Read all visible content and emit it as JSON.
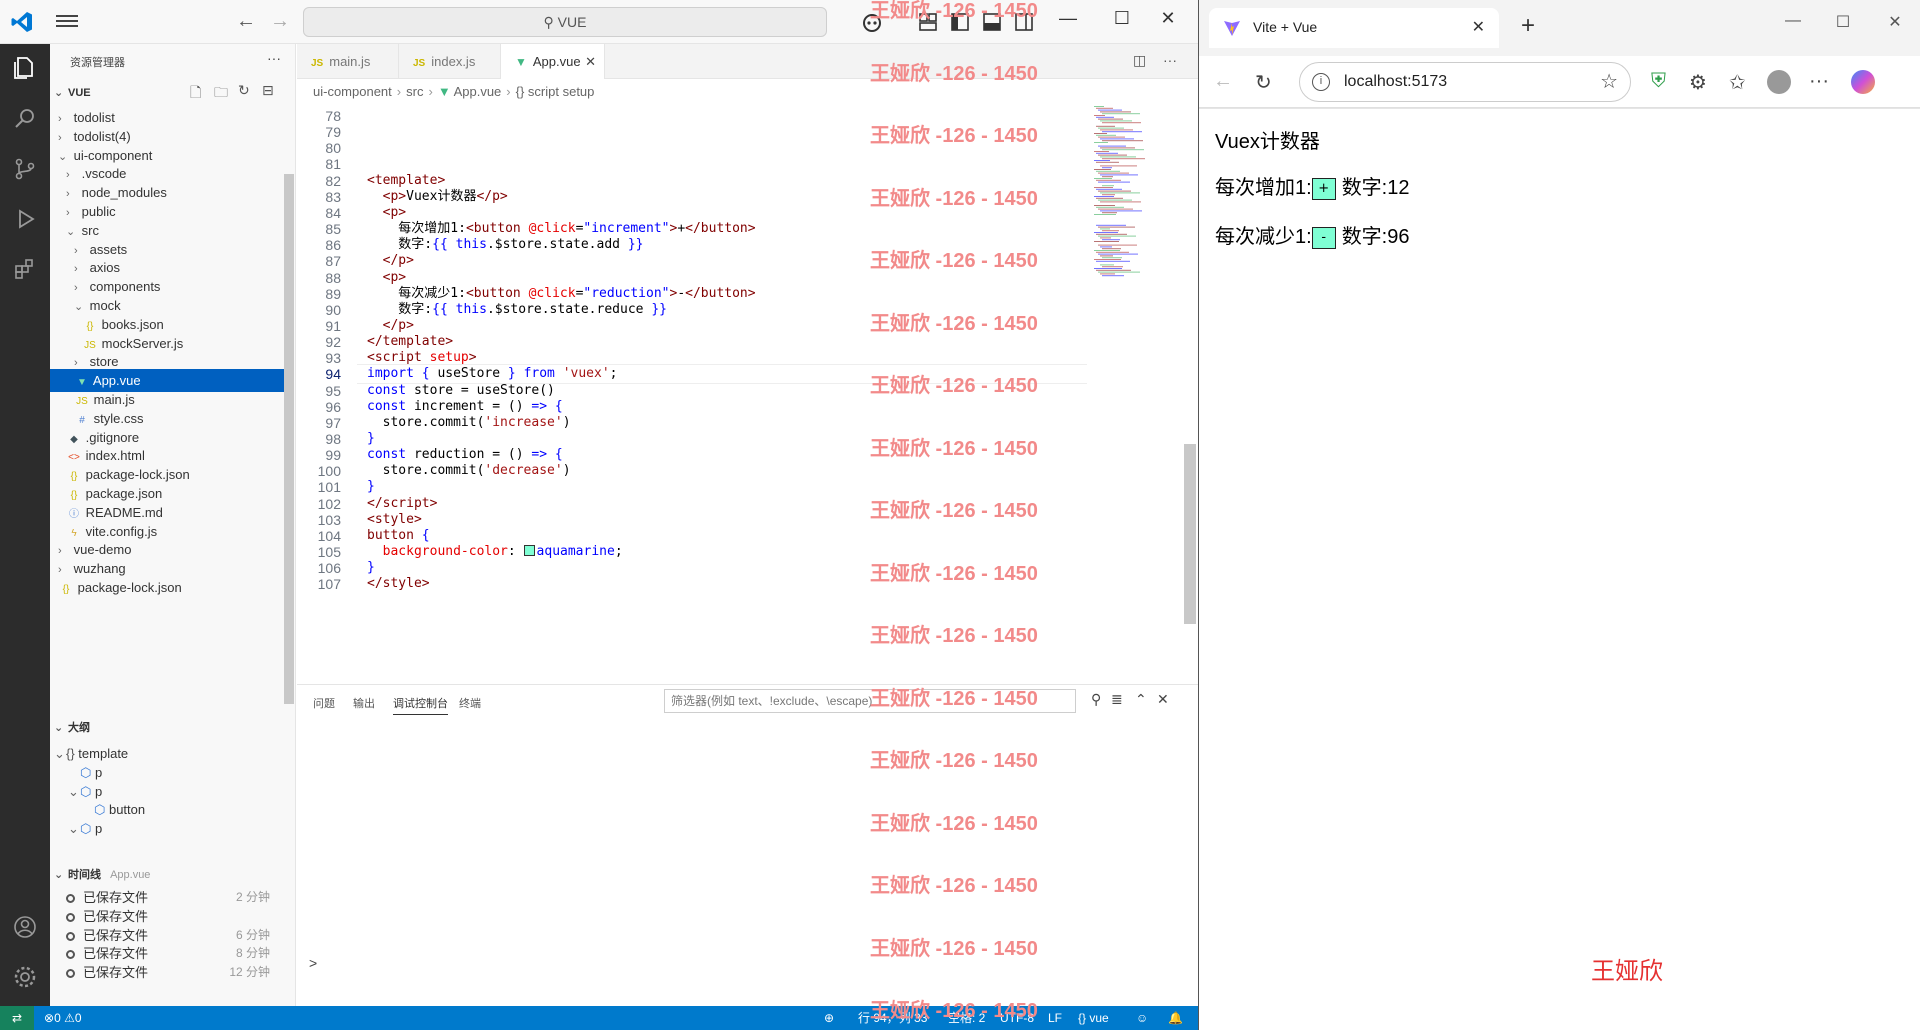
{
  "colors": {
    "vscode_accent": "#007acc",
    "selection": "#0060c0",
    "button_bg": "#7fffd4",
    "watermark": "#f28a8a",
    "name_tag": "#e53030"
  },
  "vscode": {
    "search": "VUE",
    "explorer_title": "资源管理器",
    "root": "VUE",
    "tree": [
      {
        "label": "todolist",
        "depth": 1,
        "kind": "folder"
      },
      {
        "label": "todolist(4)",
        "depth": 1,
        "kind": "folder"
      },
      {
        "label": "ui-component",
        "depth": 1,
        "kind": "folder-open"
      },
      {
        "label": ".vscode",
        "depth": 2,
        "kind": "folder"
      },
      {
        "label": "node_modules",
        "depth": 2,
        "kind": "folder"
      },
      {
        "label": "public",
        "depth": 2,
        "kind": "folder"
      },
      {
        "label": "src",
        "depth": 2,
        "kind": "folder-open"
      },
      {
        "label": "assets",
        "depth": 3,
        "kind": "folder"
      },
      {
        "label": "axios",
        "depth": 3,
        "kind": "folder"
      },
      {
        "label": "components",
        "depth": 3,
        "kind": "folder"
      },
      {
        "label": "mock",
        "depth": 3,
        "kind": "folder-open"
      },
      {
        "label": "books.json",
        "depth": 4,
        "kind": "json"
      },
      {
        "label": "mockServer.js",
        "depth": 4,
        "kind": "js"
      },
      {
        "label": "store",
        "depth": 3,
        "kind": "folder"
      },
      {
        "label": "App.vue",
        "depth": 3,
        "kind": "vue",
        "selected": true
      },
      {
        "label": "main.js",
        "depth": 3,
        "kind": "js"
      },
      {
        "label": "style.css",
        "depth": 3,
        "kind": "css"
      },
      {
        "label": ".gitignore",
        "depth": 2,
        "kind": "git"
      },
      {
        "label": "index.html",
        "depth": 2,
        "kind": "html"
      },
      {
        "label": "package-lock.json",
        "depth": 2,
        "kind": "json"
      },
      {
        "label": "package.json",
        "depth": 2,
        "kind": "json"
      },
      {
        "label": "README.md",
        "depth": 2,
        "kind": "info"
      },
      {
        "label": "vite.config.js",
        "depth": 2,
        "kind": "vite"
      },
      {
        "label": "vue-demo",
        "depth": 1,
        "kind": "folder"
      },
      {
        "label": "wuzhang",
        "depth": 1,
        "kind": "folder"
      },
      {
        "label": "package-lock.json",
        "depth": 1,
        "kind": "json"
      }
    ],
    "outline_title": "大纲",
    "outline": [
      {
        "label": "template",
        "depth": 1,
        "icon": "braces"
      },
      {
        "label": "p",
        "depth": 2,
        "icon": "cube"
      },
      {
        "label": "p",
        "depth": 2,
        "icon": "cube",
        "open": true
      },
      {
        "label": "button",
        "depth": 3,
        "icon": "cube"
      },
      {
        "label": "p",
        "depth": 2,
        "icon": "cube",
        "open": true
      }
    ],
    "timeline_title": "时间线",
    "timeline_file": "App.vue",
    "timeline": [
      {
        "label": "已保存文件",
        "when": "2 分钟"
      },
      {
        "label": "已保存文件",
        "when": ""
      },
      {
        "label": "已保存文件",
        "when": "6 分钟"
      },
      {
        "label": "已保存文件",
        "when": "8 分钟"
      },
      {
        "label": "已保存文件",
        "when": "12 分钟"
      }
    ],
    "tabs": [
      {
        "label": "main.js",
        "kind": "js"
      },
      {
        "label": "index.js",
        "kind": "js"
      },
      {
        "label": "App.vue",
        "kind": "vue",
        "active": true
      }
    ],
    "breadcrumb": [
      "ui-component",
      "src",
      "App.vue",
      "script setup"
    ],
    "code": [
      {
        "n": "78",
        "html": ""
      },
      {
        "n": "79",
        "html": ""
      },
      {
        "n": "80",
        "html": ""
      },
      {
        "n": "81",
        "html": ""
      },
      {
        "n": "82",
        "html": "<span class=\"tag\">&lt;template&gt;</span>"
      },
      {
        "n": "83",
        "html": "  <span class=\"tag\">&lt;p&gt;</span>Vuex计数器<span class=\"tag\">&lt;/p&gt;</span>"
      },
      {
        "n": "84",
        "html": "  <span class=\"tag\">&lt;p&gt;</span>"
      },
      {
        "n": "85",
        "html": "    每次增加1:<span class=\"tag\">&lt;button</span> <span class=\"attr\">@click</span>=<span class=\"kw\">\"increment\"</span><span class=\"tag\">&gt;</span>+<span class=\"tag\">&lt;/button&gt;</span>"
      },
      {
        "n": "86",
        "html": "    数字:<span class=\"kw\">{{ this</span>.$store.state.add <span class=\"kw\">}}</span>"
      },
      {
        "n": "87",
        "html": "  <span class=\"tag\">&lt;/p&gt;</span>"
      },
      {
        "n": "88",
        "html": "  <span class=\"tag\">&lt;p&gt;</span>"
      },
      {
        "n": "89",
        "html": "    每次减少1:<span class=\"tag\">&lt;button</span> <span class=\"attr\">@click</span>=<span class=\"kw\">\"reduction\"</span><span class=\"tag\">&gt;</span>-<span class=\"tag\">&lt;/button&gt;</span>"
      },
      {
        "n": "90",
        "html": "    数字:<span class=\"kw\">{{ this</span>.$store.state.reduce <span class=\"kw\">}}</span>"
      },
      {
        "n": "91",
        "html": "  <span class=\"tag\">&lt;/p&gt;</span>"
      },
      {
        "n": "92",
        "html": "<span class=\"tag\">&lt;/template&gt;</span>"
      },
      {
        "n": "93",
        "html": "<span class=\"tag\">&lt;script</span> <span class=\"attr\">setup</span><span class=\"tag\">&gt;</span>"
      },
      {
        "n": "94",
        "html": "<span class=\"kw\">import</span> <span class=\"kw\">{</span> useStore <span class=\"kw\">}</span> <span class=\"kw\">from</span> <span class=\"str\">'vuex'</span>;",
        "current": true
      },
      {
        "n": "95",
        "html": "<span class=\"kw\">const</span> store = useStore()"
      },
      {
        "n": "96",
        "html": "<span class=\"kw\">const</span> increment = () <span class=\"kw\">=&gt;</span> <span class=\"kw\">{</span>"
      },
      {
        "n": "97",
        "html": "  store.commit(<span class=\"str\">'increase'</span>)"
      },
      {
        "n": "98",
        "html": "<span class=\"kw\">}</span>"
      },
      {
        "n": "99",
        "html": "<span class=\"kw\">const</span> reduction = () <span class=\"kw\">=&gt;</span> <span class=\"kw\">{</span>"
      },
      {
        "n": "100",
        "html": "  store.commit(<span class=\"str\">'decrease'</span>)"
      },
      {
        "n": "101",
        "html": "<span class=\"kw\">}</span>"
      },
      {
        "n": "102",
        "html": "<span class=\"tag\">&lt;/script&gt;</span>"
      },
      {
        "n": "103",
        "html": "<span class=\"tag\">&lt;style&gt;</span>"
      },
      {
        "n": "104",
        "html": "<span class=\"tag\">button</span> <span class=\"kw\">{</span>"
      },
      {
        "n": "105",
        "html": "  <span class=\"prop\">background-color</span>: <span class=\"swatch\"></span><span class=\"kw\">aquamarine</span>;"
      },
      {
        "n": "106",
        "html": "<span class=\"kw\">}</span>"
      },
      {
        "n": "107",
        "html": "<span class=\"tag\">&lt;/style&gt;</span>"
      }
    ],
    "panel_tabs": [
      "问题",
      "输出",
      "调试控制台",
      "终端"
    ],
    "panel_active": 2,
    "filter_placeholder": "筛选器(例如 text、!exclude、\\escape)",
    "prompt": ">",
    "status": {
      "problems": "0",
      "warnings": "0",
      "position": "行 94，列 33",
      "spaces": "空格: 2",
      "encoding": "UTF-8",
      "eol": "LF",
      "language": "vue"
    },
    "watermark": "王娅欣 -126 - 1450"
  },
  "browser": {
    "tab_title": "Vite + Vue",
    "url": "localhost:5173",
    "app": {
      "title": "Vuex计数器",
      "inc_label": "每次增加1:",
      "inc_button": "+",
      "inc_count_label": "数字:",
      "inc_value": "12",
      "dec_label": "每次减少1:",
      "dec_button": "-",
      "dec_count_label": "数字:",
      "dec_value": "96"
    },
    "name_tag": "王娅欣"
  }
}
